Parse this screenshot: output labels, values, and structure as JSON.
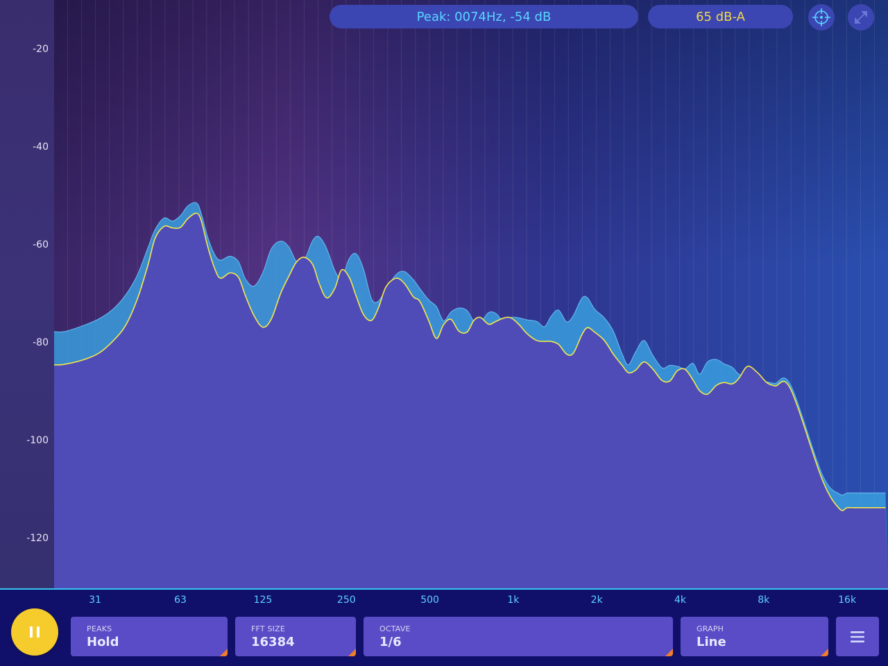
{
  "header": {
    "peak_readout": "Peak: 0074Hz, -54 dB",
    "level_readout": "65 dB-A"
  },
  "icons": {
    "target": "crosshair-target-icon",
    "expand": "expand-arrows-icon",
    "pause": "pause-icon",
    "menu": "hamburger-menu-icon"
  },
  "controls": {
    "peaks": {
      "label": "PEAKS",
      "value": "Hold"
    },
    "fft_size": {
      "label": "FFT SIZE",
      "value": "16384"
    },
    "octave": {
      "label": "OCTAVE",
      "value": "1/6"
    },
    "graph": {
      "label": "GRAPH",
      "value": "Line"
    }
  },
  "colors": {
    "accent_cyan": "#57d6ff",
    "accent_yellow": "#f2d946",
    "pause_button": "#f6cb2c",
    "tile": "#5a4cc6",
    "tile_corner": "#f07c2a",
    "spectrum_fill": "#4f4cb8",
    "peak_band": "#3a9ede"
  },
  "chart_data": {
    "type": "area",
    "x_scale": "log",
    "x_unit": "Hz",
    "y_unit": "dB",
    "xlim": [
      22,
      22000
    ],
    "ylim": [
      -130,
      -10
    ],
    "y_ticks": [
      -20,
      -40,
      -60,
      -80,
      -100,
      -120
    ],
    "x_ticks": [
      {
        "value": 31,
        "label": "31"
      },
      {
        "value": 63,
        "label": "63"
      },
      {
        "value": 125,
        "label": "125"
      },
      {
        "value": 250,
        "label": "250"
      },
      {
        "value": 500,
        "label": "500"
      },
      {
        "value": 1000,
        "label": "1k"
      },
      {
        "value": 2000,
        "label": "2k"
      },
      {
        "value": 4000,
        "label": "4k"
      },
      {
        "value": 8000,
        "label": "8k"
      },
      {
        "value": 16000,
        "label": "16k"
      }
    ],
    "grid": "vertical",
    "series": [
      {
        "role": "peak-hold",
        "points": [
          [
            22,
            -77.8
          ],
          [
            24,
            -77.8
          ],
          [
            28,
            -76.6
          ],
          [
            32,
            -75.2
          ],
          [
            36,
            -73.2
          ],
          [
            40,
            -70.3
          ],
          [
            44,
            -66.3
          ],
          [
            48,
            -60.8
          ],
          [
            51,
            -57.0
          ],
          [
            55,
            -54.6
          ],
          [
            59,
            -55.2
          ],
          [
            63,
            -54.1
          ],
          [
            67,
            -52.1
          ],
          [
            72,
            -51.5
          ],
          [
            75,
            -53.8
          ],
          [
            79,
            -58.5
          ],
          [
            84,
            -62.2
          ],
          [
            88,
            -63.2
          ],
          [
            95,
            -62.4
          ],
          [
            102,
            -63.5
          ],
          [
            108,
            -67.0
          ],
          [
            116,
            -68.5
          ],
          [
            125,
            -65.7
          ],
          [
            134,
            -60.9
          ],
          [
            145,
            -59.3
          ],
          [
            155,
            -60.5
          ],
          [
            165,
            -63.4
          ],
          [
            176,
            -63.2
          ],
          [
            189,
            -59.2
          ],
          [
            199,
            -58.4
          ],
          [
            212,
            -60.8
          ],
          [
            227,
            -65.3
          ],
          [
            240,
            -66.9
          ],
          [
            256,
            -62.9
          ],
          [
            271,
            -61.9
          ],
          [
            288,
            -65.0
          ],
          [
            308,
            -71.1
          ],
          [
            326,
            -71.6
          ],
          [
            347,
            -69.2
          ],
          [
            377,
            -66.2
          ],
          [
            404,
            -65.5
          ],
          [
            436,
            -67.2
          ],
          [
            460,
            -69.0
          ],
          [
            495,
            -71.3
          ],
          [
            528,
            -72.7
          ],
          [
            560,
            -75.6
          ],
          [
            596,
            -73.8
          ],
          [
            636,
            -73.0
          ],
          [
            681,
            -73.5
          ],
          [
            721,
            -75.7
          ],
          [
            761,
            -75.9
          ],
          [
            815,
            -73.9
          ],
          [
            866,
            -74.1
          ],
          [
            926,
            -75.9
          ],
          [
            982,
            -74.9
          ],
          [
            1050,
            -75.0
          ],
          [
            1120,
            -75.4
          ],
          [
            1212,
            -75.7
          ],
          [
            1295,
            -76.8
          ],
          [
            1368,
            -74.7
          ],
          [
            1455,
            -73.4
          ],
          [
            1558,
            -75.8
          ],
          [
            1647,
            -74.5
          ],
          [
            1766,
            -71.0
          ],
          [
            1850,
            -70.9
          ],
          [
            1965,
            -73.2
          ],
          [
            2130,
            -75.0
          ],
          [
            2294,
            -77.7
          ],
          [
            2470,
            -82.4
          ],
          [
            2600,
            -84.6
          ],
          [
            2760,
            -82.0
          ],
          [
            2960,
            -79.6
          ],
          [
            3180,
            -82.6
          ],
          [
            3440,
            -85.2
          ],
          [
            3670,
            -84.7
          ],
          [
            3905,
            -84.9
          ],
          [
            4164,
            -85.4
          ],
          [
            4450,
            -84.3
          ],
          [
            4700,
            -86.5
          ],
          [
            5020,
            -84.0
          ],
          [
            5400,
            -83.5
          ],
          [
            5760,
            -84.4
          ],
          [
            6160,
            -85.1
          ],
          [
            6500,
            -86.5
          ],
          [
            7000,
            -87.1
          ],
          [
            7600,
            -88.1
          ],
          [
            8200,
            -88.1
          ],
          [
            8800,
            -88.4
          ],
          [
            10000,
            -88.7
          ],
          [
            13000,
            -107
          ],
          [
            15000,
            -111
          ],
          [
            16000,
            -110.8
          ],
          [
            17000,
            -110.8
          ],
          [
            19000,
            -110.8
          ],
          [
            22000,
            -110.8
          ]
        ]
      },
      {
        "role": "current",
        "points": [
          [
            22,
            -84.6
          ],
          [
            24,
            -84.5
          ],
          [
            28,
            -83.6
          ],
          [
            32,
            -82.2
          ],
          [
            36,
            -79.7
          ],
          [
            40,
            -76.5
          ],
          [
            44,
            -71.2
          ],
          [
            48,
            -64.4
          ],
          [
            51,
            -58.8
          ],
          [
            55,
            -56.3
          ],
          [
            59,
            -56.6
          ],
          [
            63,
            -56.5
          ],
          [
            67,
            -54.7
          ],
          [
            72,
            -53.6
          ],
          [
            75,
            -55.2
          ],
          [
            79,
            -60.4
          ],
          [
            84,
            -65.1
          ],
          [
            88,
            -66.9
          ],
          [
            95,
            -65.8
          ],
          [
            102,
            -66.7
          ],
          [
            108,
            -70.4
          ],
          [
            116,
            -74.5
          ],
          [
            125,
            -76.9
          ],
          [
            134,
            -75.2
          ],
          [
            145,
            -69.9
          ],
          [
            155,
            -66.5
          ],
          [
            165,
            -63.6
          ],
          [
            176,
            -62.6
          ],
          [
            189,
            -64.1
          ],
          [
            199,
            -67.8
          ],
          [
            212,
            -70.9
          ],
          [
            227,
            -69.0
          ],
          [
            240,
            -65.2
          ],
          [
            256,
            -66.7
          ],
          [
            271,
            -70.5
          ],
          [
            288,
            -74.3
          ],
          [
            308,
            -75.5
          ],
          [
            326,
            -73.0
          ],
          [
            347,
            -68.7
          ],
          [
            377,
            -66.9
          ],
          [
            404,
            -67.9
          ],
          [
            436,
            -70.7
          ],
          [
            460,
            -71.6
          ],
          [
            495,
            -75.5
          ],
          [
            528,
            -79.2
          ],
          [
            560,
            -76.4
          ],
          [
            596,
            -75.3
          ],
          [
            636,
            -77.7
          ],
          [
            681,
            -77.9
          ],
          [
            721,
            -75.5
          ],
          [
            761,
            -74.9
          ],
          [
            815,
            -76.3
          ],
          [
            866,
            -75.7
          ],
          [
            926,
            -75.0
          ],
          [
            982,
            -75.0
          ],
          [
            1050,
            -76.4
          ],
          [
            1120,
            -78.2
          ],
          [
            1212,
            -79.6
          ],
          [
            1295,
            -79.8
          ],
          [
            1368,
            -79.8
          ],
          [
            1455,
            -80.4
          ],
          [
            1558,
            -82.4
          ],
          [
            1647,
            -82.2
          ],
          [
            1766,
            -78.5
          ],
          [
            1850,
            -77.0
          ],
          [
            1965,
            -77.9
          ],
          [
            2130,
            -79.6
          ],
          [
            2294,
            -82.4
          ],
          [
            2470,
            -84.7
          ],
          [
            2600,
            -86.2
          ],
          [
            2760,
            -85.7
          ],
          [
            2960,
            -84.0
          ],
          [
            3180,
            -85.4
          ],
          [
            3440,
            -87.8
          ],
          [
            3670,
            -87.9
          ],
          [
            3905,
            -85.8
          ],
          [
            4164,
            -85.5
          ],
          [
            4450,
            -87.7
          ],
          [
            4700,
            -89.9
          ],
          [
            5020,
            -90.6
          ],
          [
            5400,
            -88.8
          ],
          [
            5760,
            -88.2
          ],
          [
            6160,
            -88.5
          ],
          [
            6500,
            -87.4
          ],
          [
            7000,
            -84.9
          ],
          [
            7600,
            -86.2
          ],
          [
            8200,
            -88.2
          ],
          [
            8800,
            -88.9
          ],
          [
            10000,
            -89.5
          ],
          [
            13000,
            -108
          ],
          [
            15000,
            -114
          ],
          [
            16000,
            -113.8
          ],
          [
            17000,
            -113.8
          ],
          [
            19000,
            -113.8
          ],
          [
            22000,
            -113.8
          ]
        ]
      }
    ]
  }
}
